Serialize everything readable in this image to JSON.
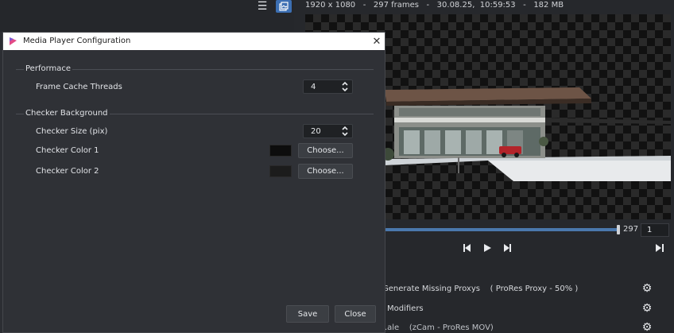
{
  "app": {
    "info_bar": "1920 x 1080   -   297 frames   -   30.08.25,  10:59:53   -   182 MB",
    "icons": [
      "menu-icon",
      "gallery-icon"
    ]
  },
  "player": {
    "frame_count": "297",
    "current_frame": "1",
    "transport": [
      "step-back-icon",
      "play-icon",
      "step-forward-icon",
      "skip-end-icon"
    ]
  },
  "tasks": [
    {
      "label": "Generate Missing Proxys    ( ProRes Proxy - 50% )"
    },
    {
      "label": "Modifiers"
    },
    {
      "label": "MetaData (.csv, .ale    (zCam - ProRes MOV)"
    }
  ],
  "dialog": {
    "title": "Media Player Configuration",
    "performance": {
      "group_title": "Performace",
      "frame_cache_label": "Frame Cache Threads",
      "frame_cache_value": "4"
    },
    "checker": {
      "group_title": "Checker Background",
      "size_label": "Checker Size (pix)",
      "size_value": "20",
      "color1_label": "Checker Color 1",
      "color1": "#0d0d0d",
      "color2_label": "Checker Color 2",
      "color2": "#1c1c1c",
      "choose_label": "Choose..."
    },
    "save_label": "Save",
    "close_label": "Close"
  },
  "colors": {
    "accent": "#3c6fb3",
    "timeline": "#4a78ad",
    "dialog_bg": "#2f3136",
    "logo": "#e24b86"
  }
}
